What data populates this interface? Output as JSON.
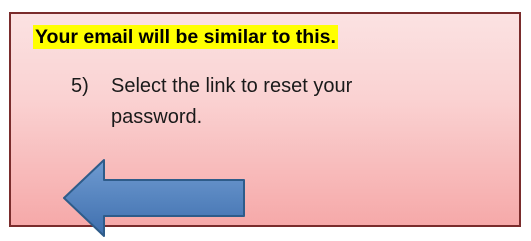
{
  "callout": {
    "headline": "Your email will be similar to this.",
    "step_number": "5)",
    "step_text": "Select the link to reset your password.",
    "arrow_icon": "left-arrow-icon",
    "colors": {
      "headline_highlight": "#ffff00",
      "card_gradient_top": "#fbe2e2",
      "card_gradient_bottom": "#f6a9a9",
      "card_border": "#7a2c2c",
      "arrow_fill": "#4f81bd",
      "arrow_stroke": "#2e5c8a"
    }
  }
}
